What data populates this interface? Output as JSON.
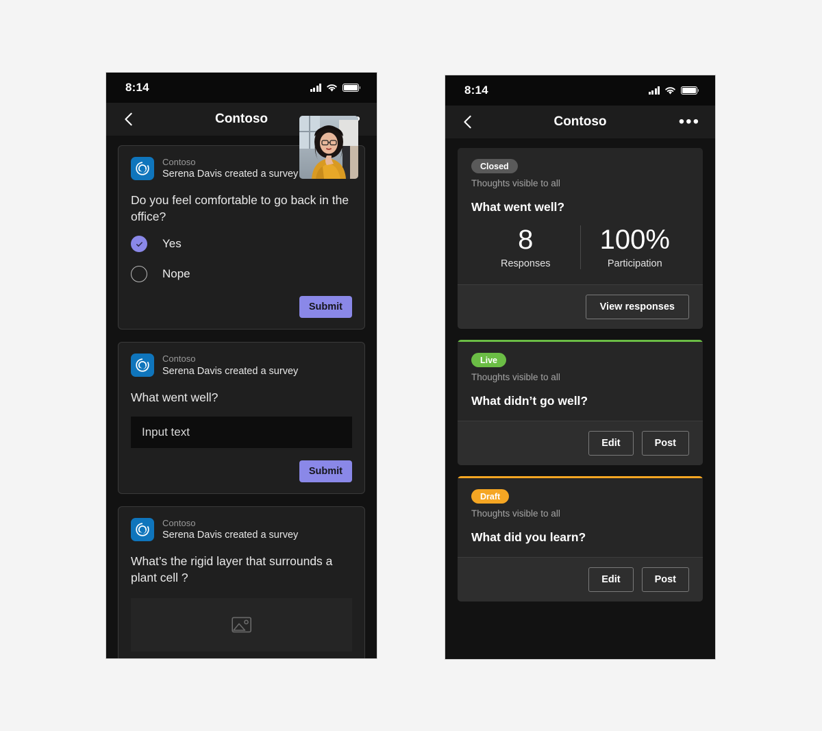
{
  "statusbar": {
    "time": "8:14",
    "signal_icon": "signal-bars-icon",
    "wifi_icon": "wifi-icon",
    "battery_icon": "battery-icon"
  },
  "navbar": {
    "title": "Contoso",
    "back_icon": "chevron-left-icon",
    "more_icon": "more-horizontal-icon"
  },
  "colors": {
    "accent_purple": "#8a88e8",
    "accent_green": "#6bbd45",
    "accent_orange": "#f5a623",
    "badge_gray": "#5a5a5a",
    "app_icon_blue": "#0f75bc",
    "card_bg": "#1f1f1f",
    "phone_bg": "#121212"
  },
  "left_phone": {
    "cards": [
      {
        "app_name": "Contoso",
        "subtitle": "Serena Davis created a survey",
        "question": "Do you feel comfortable to go back in the office?",
        "options": [
          {
            "label": "Yes",
            "selected": true
          },
          {
            "label": "Nope",
            "selected": false
          }
        ],
        "submit_label": "Submit",
        "has_photo": true
      },
      {
        "app_name": "Contoso",
        "subtitle": "Serena Davis created a survey",
        "question": "What went well?",
        "input_value": "Input text",
        "submit_label": "Submit"
      },
      {
        "app_name": "Contoso",
        "subtitle": "Serena Davis created a survey",
        "question": "What’s the rigid layer that surrounds a plant cell ?",
        "image_placeholder_icon": "image-placeholder-icon"
      }
    ]
  },
  "right_phone": {
    "cards": [
      {
        "status": "Closed",
        "status_color": "#5a5a5a",
        "accent_color": "transparent",
        "visibility": "Thoughts visible to all",
        "question": "What went well?",
        "stats": [
          {
            "value": "8",
            "label": "Responses"
          },
          {
            "value": "100%",
            "label": "Participation"
          }
        ],
        "actions": [
          "View responses"
        ]
      },
      {
        "status": "Live",
        "status_color": "#6bbd45",
        "accent_color": "#6bbd45",
        "visibility": "Thoughts visible to all",
        "question": "What didn’t go well?",
        "actions": [
          "Edit",
          "Post"
        ]
      },
      {
        "status": "Draft",
        "status_color": "#f5a623",
        "accent_color": "#f5a623",
        "visibility": "Thoughts visible to all",
        "question": "What did you learn?",
        "actions": [
          "Edit",
          "Post"
        ]
      }
    ]
  }
}
